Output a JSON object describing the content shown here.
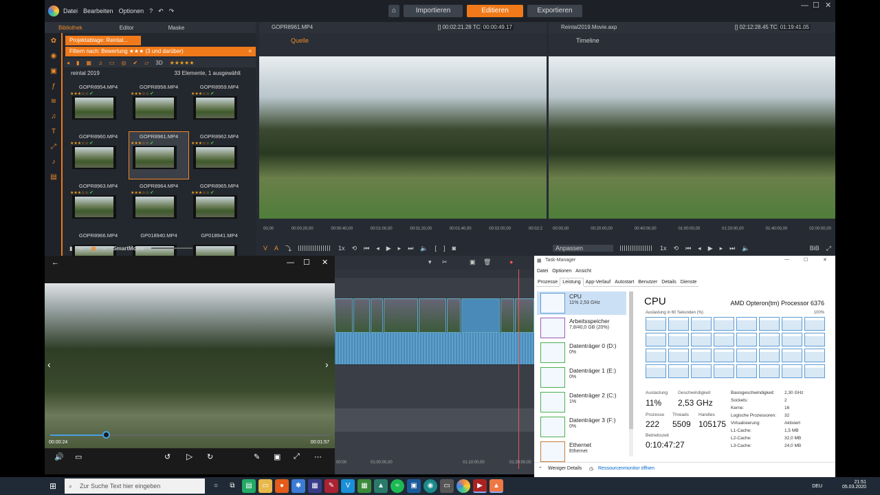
{
  "app": {
    "menu": [
      "Datei",
      "Bearbeiten",
      "Optionen"
    ],
    "help_icon": "question-circle-icon",
    "tabs": [
      "Importieren",
      "Editieren",
      "Exportieren"
    ],
    "active_tab": "Editieren",
    "accent": "#f07a1a"
  },
  "library": {
    "tabs": [
      "Bibliothek",
      "Editor",
      "Maske"
    ],
    "project_tab": "Projektablage: Reintal...",
    "filter_label": "Filtern nach:",
    "filter_value": "Bewertung ★★★ (3 und darüber)",
    "threed_label": "3D",
    "folder": "reintal 2019",
    "folder_count": "33 Elemente, 1 ausgewählt",
    "items": [
      {
        "name": "GOPR8954.MP4",
        "stars": "★★★☆☆"
      },
      {
        "name": "GOPR8958.MP4",
        "stars": "★★★☆☆"
      },
      {
        "name": "GOPR8959.MP4",
        "stars": "★★★☆☆"
      },
      {
        "name": "GOPR8960.MP4",
        "stars": "★★★☆☆"
      },
      {
        "name": "GOPR8961.MP4",
        "stars": "★★★☆☆"
      },
      {
        "name": "GOPR8962.MP4",
        "stars": "★★★☆☆"
      },
      {
        "name": "GOPR8963.MP4",
        "stars": "★★★☆☆"
      },
      {
        "name": "GOPR8964.MP4",
        "stars": "★★★☆☆"
      },
      {
        "name": "GOPR8965.MP4",
        "stars": "★★★☆☆"
      },
      {
        "name": "GOPR8966.MP4",
        "stars": ""
      },
      {
        "name": "GP018940.MP4",
        "stars": ""
      },
      {
        "name": "GP018941.MP4",
        "stars": ""
      }
    ],
    "smartmovie": "SmartMovie"
  },
  "source": {
    "file": "GOPR8961.MP4",
    "duration": "[] 00:02:21.28",
    "tc_label": "TC",
    "tc": "00:00:49.17",
    "title": "Quelle",
    "ticks": [
      "00,00",
      "00:00:20,00",
      "00:00:40,00",
      "00:01:00,00",
      "00:01:20,00",
      "00:01:40,00",
      "00:02:00,00",
      "00:02:2"
    ],
    "speed": "1x",
    "va_v": "V",
    "va_a": "A"
  },
  "timeline_pane": {
    "file": "Reintal2019.Movie.axp",
    "duration": "[] 02:12:28.45",
    "tc_label": "TC",
    "tc": "01:19:41.05",
    "title": "Timeline",
    "ticks": [
      "00:00,00",
      "00:20:00,00",
      "00:40:00,00",
      "01:00:00,00",
      "01:20:00,00",
      "01:40:00,00",
      "02:00:00,00"
    ],
    "fit": "Anpassen",
    "speed": "1x",
    "bib": "BiB"
  },
  "player": {
    "elapsed": "00:00:24",
    "total": "00:01:57",
    "progress": 0.2
  },
  "timeline": {
    "ruler": [
      "01:00:00,00",
      "01:10:00,00",
      "01:20:00,00"
    ],
    "ruler_left": "00:00"
  },
  "taskmanager": {
    "title": "Task-Manager",
    "menu": [
      "Datei",
      "Optionen",
      "Ansicht"
    ],
    "tabs": [
      "Prozesse",
      "Leistung",
      "App-Verlauf",
      "Autostart",
      "Benutzer",
      "Details",
      "Dienste"
    ],
    "resources": [
      {
        "name": "CPU",
        "value": "11% 2,53 GHz"
      },
      {
        "name": "Arbeitsspeicher",
        "value": "7,8/40,0 GB (20%)"
      },
      {
        "name": "Datenträger 0 (D:)",
        "value": "0%"
      },
      {
        "name": "Datenträger 1 (E:)",
        "value": "0%"
      },
      {
        "name": "Datenträger 2 (C:)",
        "value": "1%"
      },
      {
        "name": "Datenträger 3 (F:)",
        "value": "0%"
      },
      {
        "name": "Ethernet",
        "value": "Ethernet"
      }
    ],
    "cpu_title": "CPU",
    "cpu_model": "AMD Opteron(tm) Processor 6376",
    "graph_caption": "Auslastung in 60 Sekunden (%)",
    "graph_max": "100%",
    "stats": {
      "auslastung_label": "Auslastung",
      "auslastung": "11%",
      "geschw_label": "Geschwindigkeit",
      "geschw": "2,53 GHz",
      "prozesse_label": "Prozesse",
      "prozesse": "222",
      "threads_label": "Threads",
      "threads": "5509",
      "handles_label": "Handles",
      "handles": "105175",
      "betrieb_label": "Betriebszeit",
      "betrieb": "0:10:47:27"
    },
    "specs": [
      [
        "Basisgeschwindigkeit:",
        "2,30 GHz"
      ],
      [
        "Sockets:",
        "2"
      ],
      [
        "Kerne:",
        "16"
      ],
      [
        "Logische Prozessoren:",
        "32"
      ],
      [
        "Virtualisierung:",
        "Aktiviert"
      ],
      [
        "L1-Cache:",
        "1,5 MB"
      ],
      [
        "L2-Cache:",
        "32,0 MB"
      ],
      [
        "L3-Cache:",
        "24,0 MB"
      ]
    ],
    "fewer": "Weniger Details",
    "resmon": "Ressourcenmonitor öffnen"
  },
  "taskbar": {
    "search_placeholder": "Zur Suche Text hier eingeben",
    "lang": "DEU",
    "time": "21:51",
    "date": "05.03.2020"
  }
}
